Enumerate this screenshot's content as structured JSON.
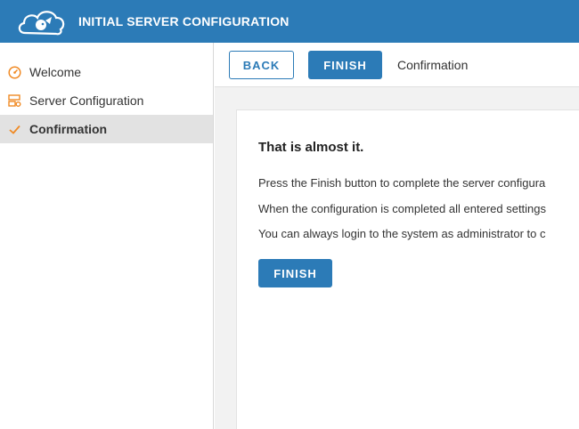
{
  "header": {
    "title": "INITIAL SERVER CONFIGURATION",
    "logo_icon": "cloud-mascot-logo"
  },
  "sidebar": {
    "items": [
      {
        "label": "Welcome",
        "icon": "dashboard-icon",
        "active": false
      },
      {
        "label": "Server Configuration",
        "icon": "server-settings-icon",
        "active": false
      },
      {
        "label": "Confirmation",
        "icon": "check-icon",
        "active": true
      }
    ]
  },
  "toolbar": {
    "back_label": "BACK",
    "finish_label": "FINISH",
    "breadcrumb": "Confirmation"
  },
  "main": {
    "title": "That is almost it.",
    "paragraphs": [
      "Press the Finish button to complete the server configura",
      "When the configuration is completed all entered settings",
      "You can always login to the system as administrator to c"
    ],
    "finish_label": "FINISH"
  },
  "colors": {
    "brand": "#2c7bb7",
    "icon_accent": "#f08a24",
    "active_bg": "#e2e2e2",
    "content_bg": "#f2f2f2"
  }
}
